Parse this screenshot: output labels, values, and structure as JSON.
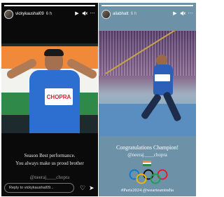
{
  "left_story": {
    "username": "vickykaushal09",
    "time": "6 h",
    "jersey_text": "CHOPRA",
    "caption_line1": "Season Best performance.",
    "caption_line2": "You always make us proud brother",
    "mention": "@neeraj____chopra",
    "reply_placeholder": "Reply to vickykaushal09...",
    "progress": 1.0
  },
  "right_story": {
    "username": "aliabhatt",
    "time": "6 h",
    "caption_line1": "Congratulations Champion!",
    "mention": "@neeraj____chopra",
    "hashtags": "#Paris2024 @wearteamindia",
    "progress": 1.0
  },
  "icons": {
    "play": "play-icon",
    "mute": "mute-icon",
    "more": "more-icon",
    "heart": "heart-icon",
    "send": "send-icon"
  }
}
